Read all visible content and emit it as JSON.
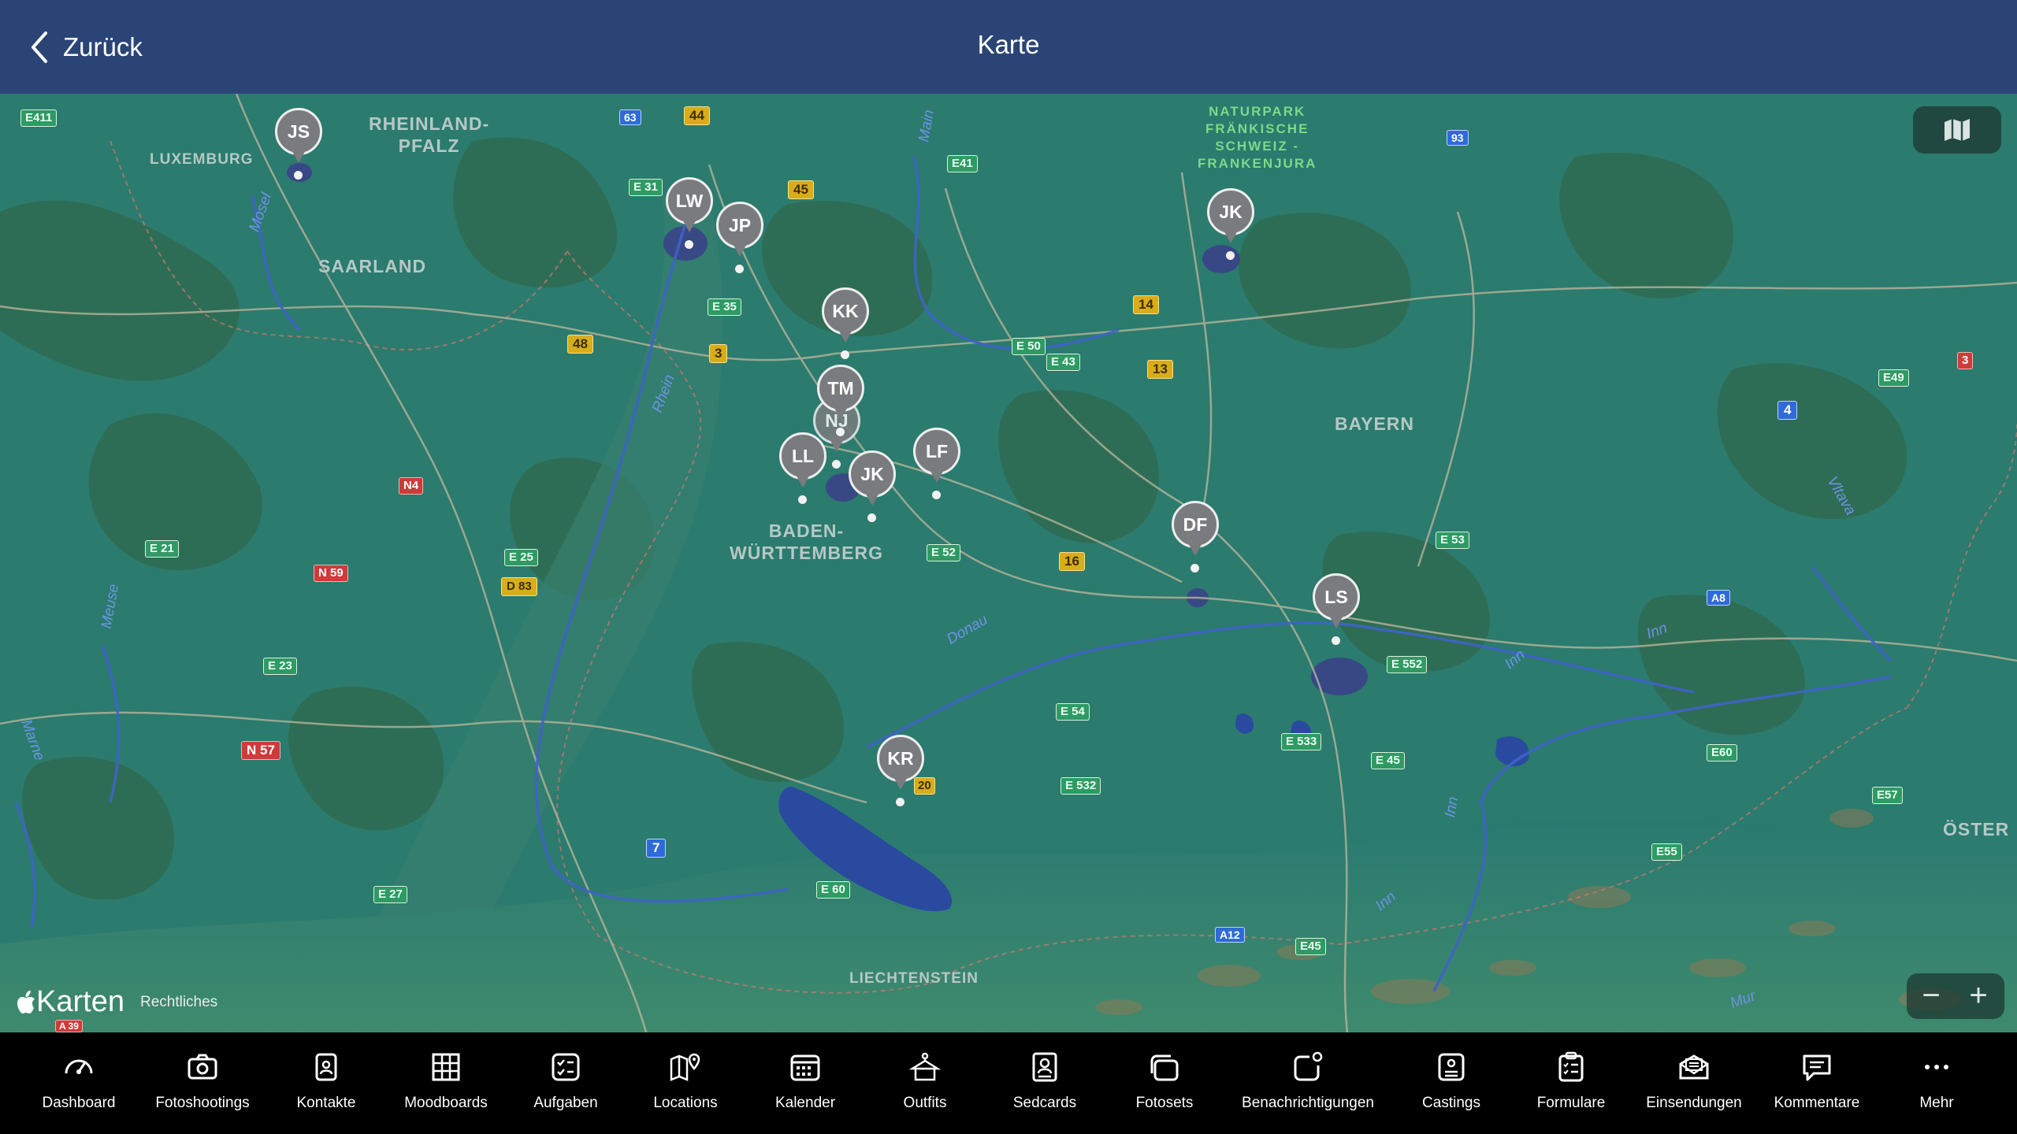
{
  "header": {
    "back_label": "Zurück",
    "title": "Karte"
  },
  "map": {
    "attribution_brand": "Karten",
    "attribution_legal": "Rechtliches",
    "zoom_out": "−",
    "zoom_in": "+",
    "regions": [
      "RHEINLAND-\nPFALZ",
      "LUXEMBURG",
      "SAARLAND",
      "BADEN-\nWÜRTTEMBERG",
      "BAYERN",
      "LIECHTENSTEIN",
      "ÖSTER"
    ],
    "park": "NATURPARK\nFRÄNKISCHE\nSCHWEIZ -\nFRANKENJURA",
    "rivers": [
      "Mosel",
      "Rhein",
      "Main",
      "Donau",
      "Inn",
      "Inn",
      "Inn",
      "Inn",
      "Vltava",
      "Mur",
      "Meuse",
      "Marne"
    ],
    "roads": [
      "E411",
      "63",
      "44",
      "E 31",
      "45",
      "E41",
      "93",
      "E 35",
      "3",
      "48",
      "E 50",
      "E 43",
      "14",
      "13",
      "E49",
      "3",
      "4",
      "N4",
      "E 21",
      "E 25",
      "N 59",
      "D 83",
      "E 52",
      "16",
      "E 53",
      "A8",
      "E 552",
      "E 23",
      "N 57",
      "E 54",
      "E 533",
      "E 45",
      "E60",
      "E 532",
      "7",
      "E57",
      "E55",
      "E 60",
      "E 27",
      "A12",
      "E45",
      "A 39",
      "20"
    ],
    "pins": [
      {
        "label": "JS"
      },
      {
        "label": "LW"
      },
      {
        "label": "JP"
      },
      {
        "label": "JK"
      },
      {
        "label": "KK"
      },
      {
        "label": "TM"
      },
      {
        "label": "NJ"
      },
      {
        "label": "LL"
      },
      {
        "label": "JK"
      },
      {
        "label": "LF"
      },
      {
        "label": "DF"
      },
      {
        "label": "LS"
      },
      {
        "label": "KR"
      }
    ]
  },
  "tabs": [
    {
      "label": "Dashboard",
      "icon": "gauge-icon"
    },
    {
      "label": "Fotoshootings",
      "icon": "camera-icon"
    },
    {
      "label": "Kontakte",
      "icon": "contact-badge-icon"
    },
    {
      "label": "Moodboards",
      "icon": "grid-board-icon"
    },
    {
      "label": "Aufgaben",
      "icon": "checklist-icon"
    },
    {
      "label": "Locations",
      "icon": "map-pin-icon"
    },
    {
      "label": "Kalender",
      "icon": "calendar-icon"
    },
    {
      "label": "Outfits",
      "icon": "outfit-icon"
    },
    {
      "label": "Sedcards",
      "icon": "sedcard-icon"
    },
    {
      "label": "Fotosets",
      "icon": "photo-stack-icon"
    },
    {
      "label": "Benachrichtigungen",
      "icon": "notification-icon"
    },
    {
      "label": "Castings",
      "icon": "casting-icon"
    },
    {
      "label": "Formulare",
      "icon": "clipboard-icon"
    },
    {
      "label": "Einsendungen",
      "icon": "envelope-icon"
    },
    {
      "label": "Kommentare",
      "icon": "comment-icon"
    },
    {
      "label": "Mehr",
      "icon": "more-icon"
    }
  ]
}
